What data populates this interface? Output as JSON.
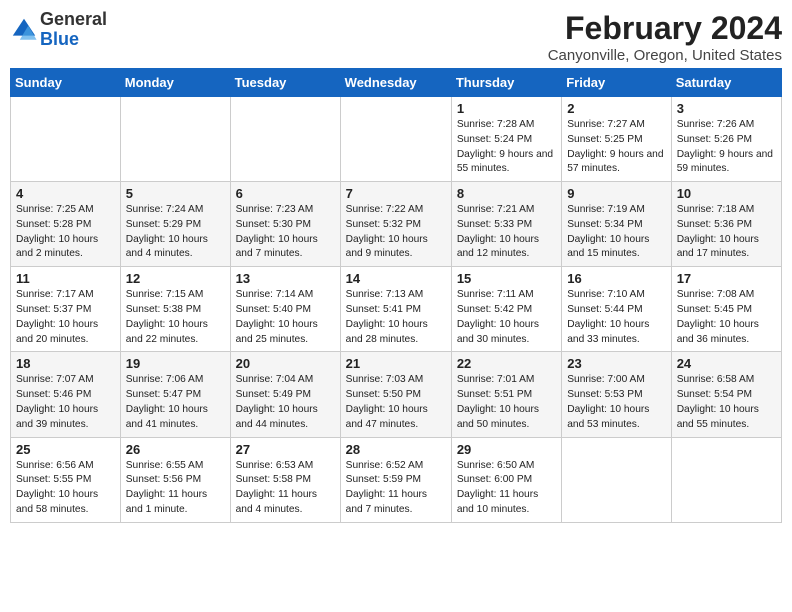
{
  "header": {
    "logo_general": "General",
    "logo_blue": "Blue",
    "title": "February 2024",
    "subtitle": "Canyonville, Oregon, United States"
  },
  "weekdays": [
    "Sunday",
    "Monday",
    "Tuesday",
    "Wednesday",
    "Thursday",
    "Friday",
    "Saturday"
  ],
  "weeks": [
    [
      {
        "day": "",
        "info": ""
      },
      {
        "day": "",
        "info": ""
      },
      {
        "day": "",
        "info": ""
      },
      {
        "day": "",
        "info": ""
      },
      {
        "day": "1",
        "info": "Sunrise: 7:28 AM\nSunset: 5:24 PM\nDaylight: 9 hours\nand 55 minutes."
      },
      {
        "day": "2",
        "info": "Sunrise: 7:27 AM\nSunset: 5:25 PM\nDaylight: 9 hours\nand 57 minutes."
      },
      {
        "day": "3",
        "info": "Sunrise: 7:26 AM\nSunset: 5:26 PM\nDaylight: 9 hours\nand 59 minutes."
      }
    ],
    [
      {
        "day": "4",
        "info": "Sunrise: 7:25 AM\nSunset: 5:28 PM\nDaylight: 10 hours\nand 2 minutes."
      },
      {
        "day": "5",
        "info": "Sunrise: 7:24 AM\nSunset: 5:29 PM\nDaylight: 10 hours\nand 4 minutes."
      },
      {
        "day": "6",
        "info": "Sunrise: 7:23 AM\nSunset: 5:30 PM\nDaylight: 10 hours\nand 7 minutes."
      },
      {
        "day": "7",
        "info": "Sunrise: 7:22 AM\nSunset: 5:32 PM\nDaylight: 10 hours\nand 9 minutes."
      },
      {
        "day": "8",
        "info": "Sunrise: 7:21 AM\nSunset: 5:33 PM\nDaylight: 10 hours\nand 12 minutes."
      },
      {
        "day": "9",
        "info": "Sunrise: 7:19 AM\nSunset: 5:34 PM\nDaylight: 10 hours\nand 15 minutes."
      },
      {
        "day": "10",
        "info": "Sunrise: 7:18 AM\nSunset: 5:36 PM\nDaylight: 10 hours\nand 17 minutes."
      }
    ],
    [
      {
        "day": "11",
        "info": "Sunrise: 7:17 AM\nSunset: 5:37 PM\nDaylight: 10 hours\nand 20 minutes."
      },
      {
        "day": "12",
        "info": "Sunrise: 7:15 AM\nSunset: 5:38 PM\nDaylight: 10 hours\nand 22 minutes."
      },
      {
        "day": "13",
        "info": "Sunrise: 7:14 AM\nSunset: 5:40 PM\nDaylight: 10 hours\nand 25 minutes."
      },
      {
        "day": "14",
        "info": "Sunrise: 7:13 AM\nSunset: 5:41 PM\nDaylight: 10 hours\nand 28 minutes."
      },
      {
        "day": "15",
        "info": "Sunrise: 7:11 AM\nSunset: 5:42 PM\nDaylight: 10 hours\nand 30 minutes."
      },
      {
        "day": "16",
        "info": "Sunrise: 7:10 AM\nSunset: 5:44 PM\nDaylight: 10 hours\nand 33 minutes."
      },
      {
        "day": "17",
        "info": "Sunrise: 7:08 AM\nSunset: 5:45 PM\nDaylight: 10 hours\nand 36 minutes."
      }
    ],
    [
      {
        "day": "18",
        "info": "Sunrise: 7:07 AM\nSunset: 5:46 PM\nDaylight: 10 hours\nand 39 minutes."
      },
      {
        "day": "19",
        "info": "Sunrise: 7:06 AM\nSunset: 5:47 PM\nDaylight: 10 hours\nand 41 minutes."
      },
      {
        "day": "20",
        "info": "Sunrise: 7:04 AM\nSunset: 5:49 PM\nDaylight: 10 hours\nand 44 minutes."
      },
      {
        "day": "21",
        "info": "Sunrise: 7:03 AM\nSunset: 5:50 PM\nDaylight: 10 hours\nand 47 minutes."
      },
      {
        "day": "22",
        "info": "Sunrise: 7:01 AM\nSunset: 5:51 PM\nDaylight: 10 hours\nand 50 minutes."
      },
      {
        "day": "23",
        "info": "Sunrise: 7:00 AM\nSunset: 5:53 PM\nDaylight: 10 hours\nand 53 minutes."
      },
      {
        "day": "24",
        "info": "Sunrise: 6:58 AM\nSunset: 5:54 PM\nDaylight: 10 hours\nand 55 minutes."
      }
    ],
    [
      {
        "day": "25",
        "info": "Sunrise: 6:56 AM\nSunset: 5:55 PM\nDaylight: 10 hours\nand 58 minutes."
      },
      {
        "day": "26",
        "info": "Sunrise: 6:55 AM\nSunset: 5:56 PM\nDaylight: 11 hours\nand 1 minute."
      },
      {
        "day": "27",
        "info": "Sunrise: 6:53 AM\nSunset: 5:58 PM\nDaylight: 11 hours\nand 4 minutes."
      },
      {
        "day": "28",
        "info": "Sunrise: 6:52 AM\nSunset: 5:59 PM\nDaylight: 11 hours\nand 7 minutes."
      },
      {
        "day": "29",
        "info": "Sunrise: 6:50 AM\nSunset: 6:00 PM\nDaylight: 11 hours\nand 10 minutes."
      },
      {
        "day": "",
        "info": ""
      },
      {
        "day": "",
        "info": ""
      }
    ]
  ]
}
